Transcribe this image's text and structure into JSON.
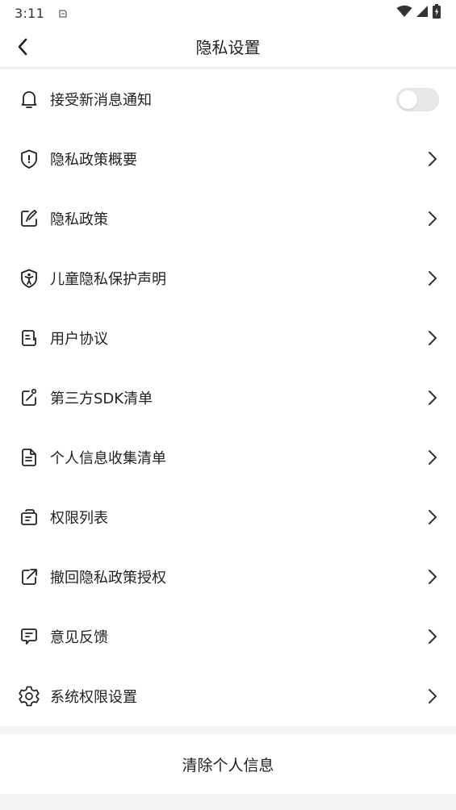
{
  "status_bar": {
    "time": "3:11",
    "icons": [
      "notification-icon",
      "wifi-icon",
      "signal-icon",
      "battery-icon"
    ]
  },
  "nav": {
    "title": "隐私设置",
    "back_icon": "chevron-left-icon"
  },
  "rows": [
    {
      "label": "接受新消息通知",
      "icon": "bell-icon",
      "control": "toggle",
      "toggle_on": false
    },
    {
      "label": "隐私政策概要",
      "icon": "shield-info-icon",
      "control": "chevron"
    },
    {
      "label": "隐私政策",
      "icon": "edit-note-icon",
      "control": "chevron"
    },
    {
      "label": "儿童隐私保护声明",
      "icon": "child-shield-icon",
      "control": "chevron"
    },
    {
      "label": "用户协议",
      "icon": "document-icon",
      "control": "chevron"
    },
    {
      "label": "第三方SDK清单",
      "icon": "external-edit-icon",
      "control": "chevron"
    },
    {
      "label": "个人信息收集清单",
      "icon": "file-list-icon",
      "control": "chevron"
    },
    {
      "label": "权限列表",
      "icon": "permission-bag-icon",
      "control": "chevron"
    },
    {
      "label": "撤回隐私政策授权",
      "icon": "share-out-icon",
      "control": "chevron"
    },
    {
      "label": "意见反馈",
      "icon": "feedback-chat-icon",
      "control": "chevron"
    },
    {
      "label": "系统权限设置",
      "icon": "gear-icon",
      "control": "chevron"
    }
  ],
  "clear_button": {
    "label": "清除个人信息"
  },
  "colors": {
    "background": "#f2f3f5",
    "surface": "#ffffff",
    "text": "#222222",
    "toggle_off": "#e8e8e8"
  }
}
